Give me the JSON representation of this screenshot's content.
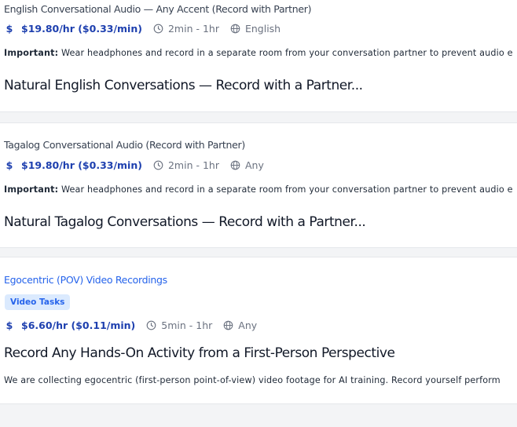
{
  "tasks": [
    {
      "task_name": "English Conversational Audio — Any Accent (Record with Partner)",
      "pay": "$19.80/hr ($0.33/min)",
      "duration": "2min - 1hr",
      "language": "English",
      "important_label": "Important:",
      "description": "Wear headphones and record in a separate room from your conversation partner to prevent audio e",
      "title": "Natural English Conversations — Record with a Partner..."
    },
    {
      "task_name": "Tagalog Conversational Audio (Record with Partner)",
      "pay": "$19.80/hr ($0.33/min)",
      "duration": "2min - 1hr",
      "language": "Any",
      "important_label": "Important:",
      "description": "Wear headphones and record in a separate room from your conversation partner to prevent audio e",
      "title": "Natural Tagalog Conversations — Record with a Partner..."
    },
    {
      "task_name": "Egocentric (POV) Video Recordings",
      "badge": "Video Tasks",
      "pay": "$6.60/hr ($0.11/min)",
      "duration": "5min - 1hr",
      "language": "Any",
      "title": "Record Any Hands-On Activity from a First-Person Perspective",
      "description": "We are collecting egocentric (first-person point-of-view) video footage for AI training. Record yourself perform"
    }
  ],
  "icons": {
    "pay": "dollar-icon",
    "duration": "clock-icon",
    "language": "globe-icon"
  },
  "colors": {
    "accent": "#1e40af",
    "link": "#2563eb",
    "badge_bg": "#dbeafe",
    "muted": "#6b7280"
  }
}
